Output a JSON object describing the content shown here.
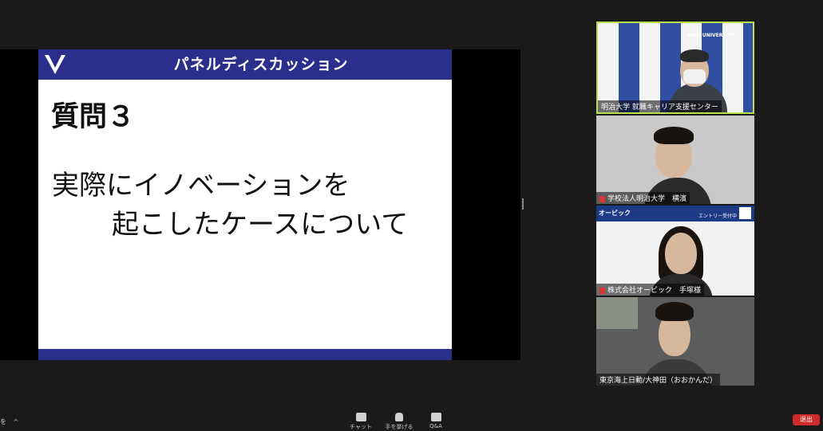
{
  "slide": {
    "title": "パネルディスカッション",
    "question": "質問３",
    "line1": "実際にイノベーションを",
    "line2": "起こしたケースについて"
  },
  "participants": [
    {
      "name": "明治大学 就職キャリア支援センター",
      "backdrop_text": "MEIJI UNIVERSITY"
    },
    {
      "name": "学校法人明治大学　横濱"
    },
    {
      "name": "株式会社オービック　手塚様",
      "banner_brand": "オービック",
      "banner_text": "エントリー受付中"
    },
    {
      "name": "東京海上日動/大神田（おおかんだ）"
    }
  ],
  "controls": {
    "left_label": "を",
    "chat": "チャット",
    "raise_hand": "手を挙げる",
    "qa": "Q&A",
    "leave": "退出"
  },
  "colors": {
    "slide_blue": "#2b2f8c",
    "active_speaker_border": "#b8e04a",
    "leave_red": "#cf2a2a"
  }
}
